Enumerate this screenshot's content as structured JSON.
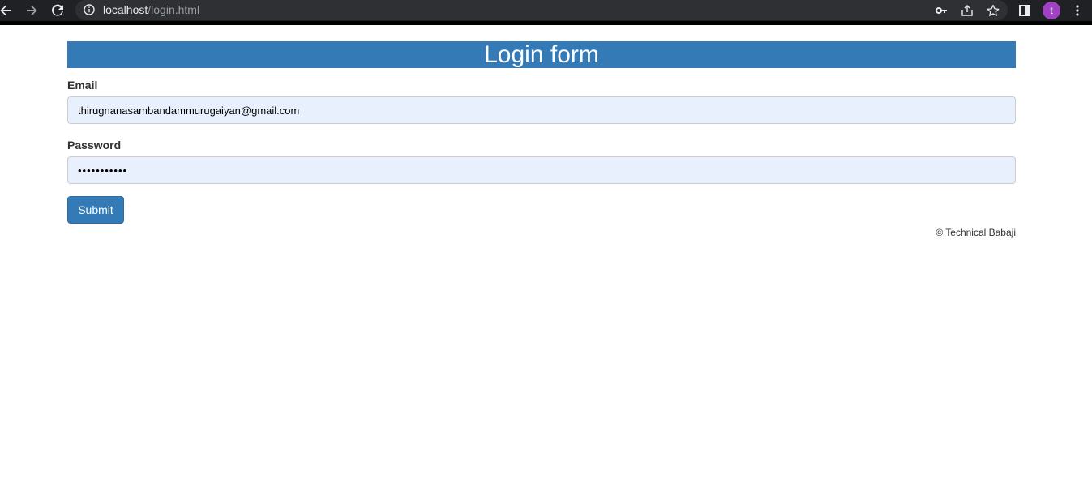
{
  "browser": {
    "url_host": "localhost",
    "url_path": "/login.html",
    "profile_initial": "t",
    "icons": [
      "back-icon",
      "forward-icon",
      "reload-icon",
      "info-icon",
      "key-icon",
      "share-icon",
      "star-icon",
      "side-panel-icon",
      "more-icon"
    ]
  },
  "page": {
    "title": "Login form",
    "email_label": "Email",
    "email_value": "thirugnanasambandammurugaiyan@gmail.com",
    "password_label": "Password",
    "password_value": "•••••••••••",
    "submit_label": "Submit",
    "footer": "© Technical Babaji"
  },
  "colors": {
    "accent": "#337ab7",
    "autofill_bg": "#e8f0fe",
    "avatar": "#a142c4"
  }
}
